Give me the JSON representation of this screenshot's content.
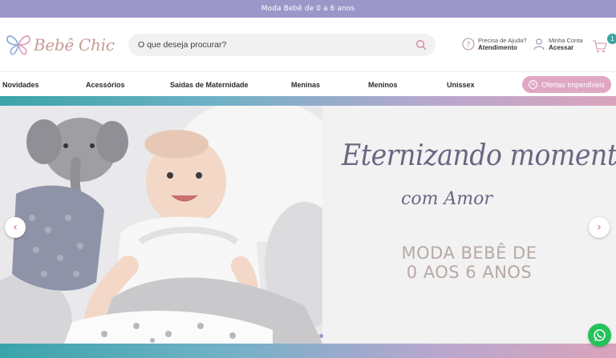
{
  "announcement": "Moda Bebê de 0 a 6 anos",
  "header": {
    "logo_text": "Bebê Chic",
    "search_placeholder": "O que deseja procurar?",
    "help_line1": "Precisa de Ajuda?",
    "help_line2": "Atendimento",
    "account_line1": "Minha Conta",
    "account_line2": "Acessar",
    "cart_count": "1"
  },
  "nav": {
    "items": [
      "Novidades",
      "Acessórios",
      "Saídas de Maternidade",
      "Meninas",
      "Meninos",
      "Unissex"
    ],
    "offers_label": "Ofertas Imperdíveis",
    "offers_icon": "%"
  },
  "hero": {
    "script_line1": "Eternizando momentos",
    "script_line2": "com Amor",
    "headline_line1": "MODA BEBÊ DE",
    "headline_line2": "0 AOS 6 ANOS",
    "prev_label": "‹",
    "next_label": "›"
  },
  "colors": {
    "announcement_bg": "#9b98c9",
    "accent_teal": "#3aa39d",
    "offers_pink": "#e0a7c3",
    "script_color": "#6b6683",
    "headline_color": "#b6a9a4",
    "whatsapp_green": "#25c15b"
  }
}
